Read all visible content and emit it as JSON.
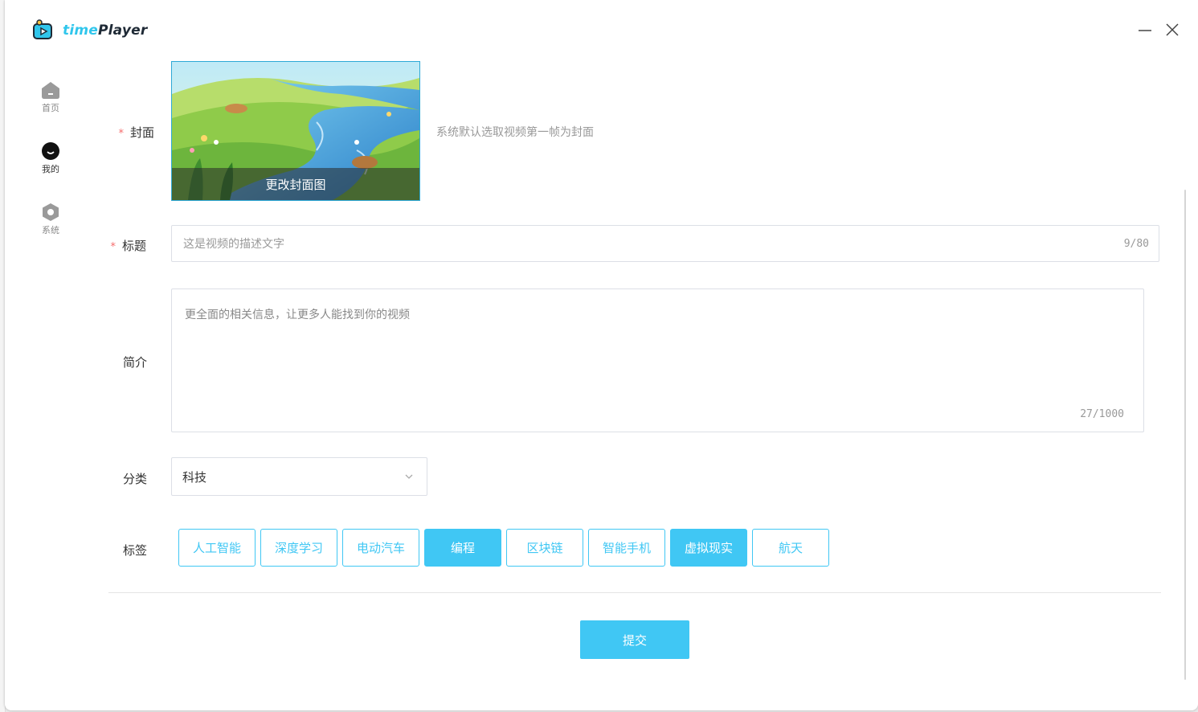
{
  "app": {
    "logo_prefix": "time",
    "logo_suffix": "Player"
  },
  "window_controls": {
    "minimize": "minimize-icon",
    "close": "close-icon"
  },
  "sidebar": {
    "items": [
      {
        "label": "首页",
        "icon": "home-icon"
      },
      {
        "label": "我的",
        "icon": "user-face-icon",
        "active": true
      },
      {
        "label": "系统",
        "icon": "settings-hexagon-icon"
      }
    ]
  },
  "form": {
    "cover": {
      "label": "封面",
      "required_mark": "*",
      "overlay_text": "更改封面图",
      "hint": "系统默认选取视频第一帧为封面"
    },
    "title": {
      "label": "标题",
      "required_mark": "*",
      "value": "这是视频的描述文字",
      "counter": "9/80"
    },
    "description": {
      "label": "简介",
      "value": "更全面的相关信息，让更多人能找到你的视频",
      "counter": "27/1000"
    },
    "category": {
      "label": "分类",
      "value": "科技"
    },
    "tags": {
      "label": "标签",
      "items": [
        {
          "text": "人工智能",
          "selected": false
        },
        {
          "text": "深度学习",
          "selected": false
        },
        {
          "text": "电动汽车",
          "selected": false
        },
        {
          "text": "编程",
          "selected": true
        },
        {
          "text": "区块链",
          "selected": false
        },
        {
          "text": "智能手机",
          "selected": false
        },
        {
          "text": "虚拟现实",
          "selected": true
        },
        {
          "text": "航天",
          "selected": false
        }
      ]
    },
    "submit_label": "提交"
  },
  "colors": {
    "accent": "#40c7f4",
    "required": "#f56c6c",
    "hint": "#999999"
  }
}
